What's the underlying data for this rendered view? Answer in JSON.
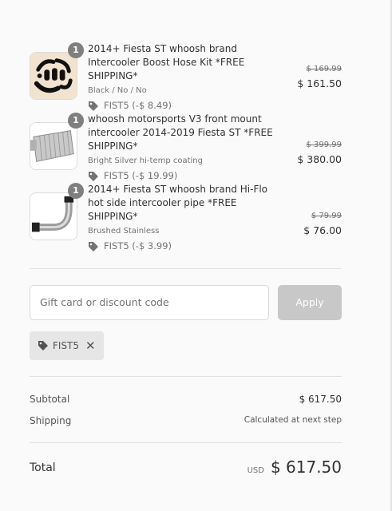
{
  "items": [
    {
      "quantity": "1",
      "title": "2014+ Fiesta ST whoosh brand Intercooler Boost Hose Kit *FREE SHIPPING*",
      "variant": "Black / No / No",
      "discount": "FIST5 (-$ 8.49)",
      "original_price": "$ 169.99",
      "price": "$ 161.50",
      "image_icon": "hose-kit-image"
    },
    {
      "quantity": "1",
      "title": "whoosh motorsports V3 front mount intercooler 2014-2019 Fiesta ST *FREE SHIPPING*",
      "variant": "Bright Silver hi-temp coating",
      "discount": "FIST5 (-$ 19.99)",
      "original_price": "$ 399.99",
      "price": "$ 380.00",
      "image_icon": "intercooler-image"
    },
    {
      "quantity": "1",
      "title": "2014+ Fiesta ST whoosh brand Hi-Flo hot side intercooler pipe *FREE SHIPPING*",
      "variant": "Brushed Stainless",
      "discount": "FIST5 (-$ 3.99)",
      "original_price": "$ 79.99",
      "price": "$ 76.00",
      "image_icon": "pipe-image"
    }
  ],
  "discount_form": {
    "placeholder": "Gift card or discount code",
    "apply_label": "Apply",
    "applied_code": "FIST5"
  },
  "summary": {
    "subtotal_label": "Subtotal",
    "subtotal_value": "$ 617.50",
    "shipping_label": "Shipping",
    "shipping_value": "Calculated at next step",
    "total_label": "Total",
    "currency": "USD",
    "total_value": "$ 617.50"
  },
  "colors": {
    "background": "#fafafa",
    "badge": "#7f7f7f",
    "apply_disabled": "#c8c8c8",
    "chip": "#e6e6e6"
  }
}
